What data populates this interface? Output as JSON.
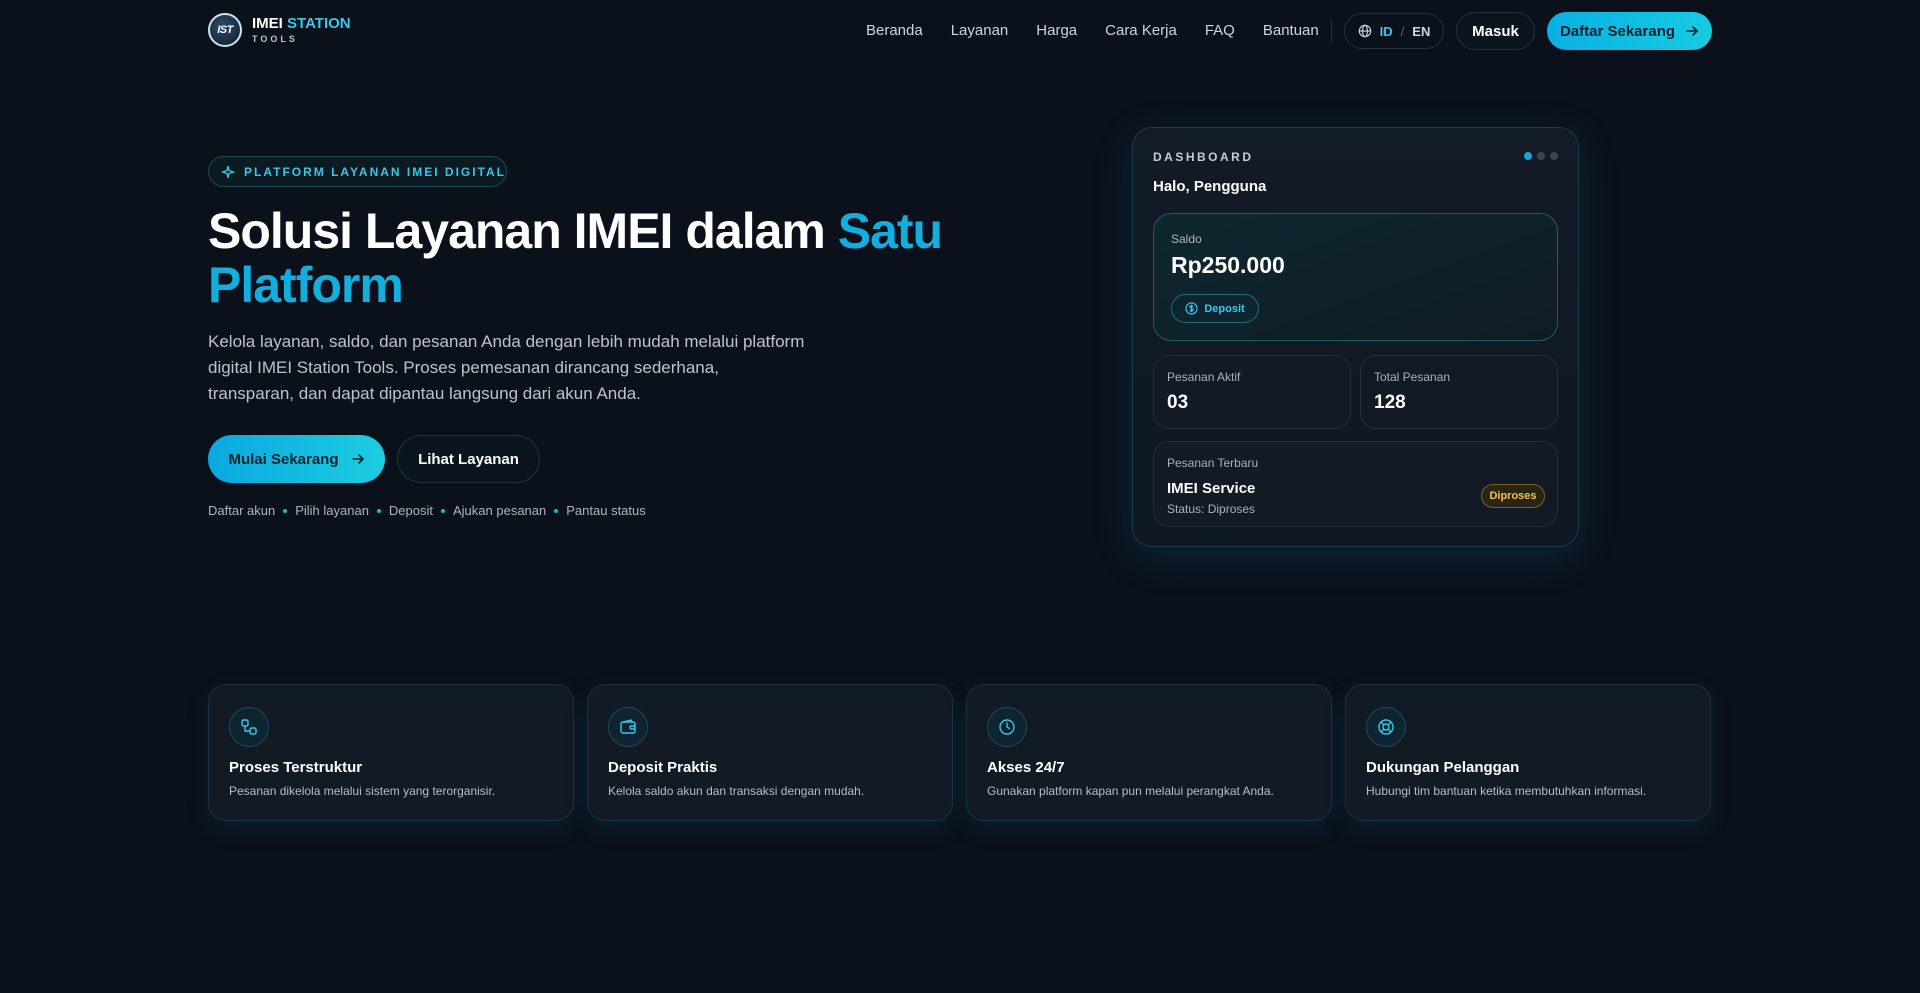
{
  "brand": {
    "logo_text": "IST",
    "name_a": "IMEI",
    "name_b": "STATION",
    "sub": "TOOLS"
  },
  "nav": {
    "items": [
      "Beranda",
      "Layanan",
      "Harga",
      "Cara Kerja",
      "FAQ",
      "Bantuan"
    ],
    "lang_id": "ID",
    "lang_sep": "/",
    "lang_en": "EN",
    "login": "Masuk",
    "signup": "Daftar Sekarang"
  },
  "hero": {
    "badge": "PLATFORM LAYANAN IMEI DIGITAL",
    "title_main": "Solusi Layanan IMEI dalam ",
    "title_highlight": "Satu Platform",
    "description": "Kelola layanan, saldo, dan pesanan Anda dengan lebih mudah melalui platform digital IMEI Station Tools. Proses pemesanan dirancang sederhana, transparan, dan dapat dipantau langsung dari akun Anda.",
    "cta_primary": "Mulai Sekarang",
    "cta_secondary": "Lihat Layanan",
    "steps": [
      "Daftar akun",
      "Pilih layanan",
      "Deposit",
      "Ajukan pesanan",
      "Pantau status"
    ]
  },
  "dashboard": {
    "label": "DASHBOARD",
    "greeting": "Halo, Pengguna",
    "saldo_label": "Saldo",
    "saldo_value": "Rp250.000",
    "deposit": "Deposit",
    "active_label": "Pesanan Aktif",
    "active_value": "03",
    "total_label": "Total Pesanan",
    "total_value": "128",
    "recent_label": "Pesanan Terbaru",
    "recent_title": "IMEI Service",
    "recent_status": "Status: Diproses",
    "recent_pill": "Diproses"
  },
  "features": [
    {
      "icon": "workflow-icon",
      "title": "Proses Terstruktur",
      "desc": "Pesanan dikelola melalui sistem yang terorganisir."
    },
    {
      "icon": "wallet-icon",
      "title": "Deposit Praktis",
      "desc": "Kelola saldo akun dan transaksi dengan mudah."
    },
    {
      "icon": "clock-icon",
      "title": "Akses 24/7",
      "desc": "Gunakan platform kapan pun melalui perangkat Anda."
    },
    {
      "icon": "lifebuoy-icon",
      "title": "Dukungan Pelanggan",
      "desc": "Hubungi tim bantuan ketika membutuhkan informasi."
    }
  ],
  "colors": {
    "accent": "#12aede",
    "background": "#0a111b",
    "pending": "#f0c24a"
  }
}
